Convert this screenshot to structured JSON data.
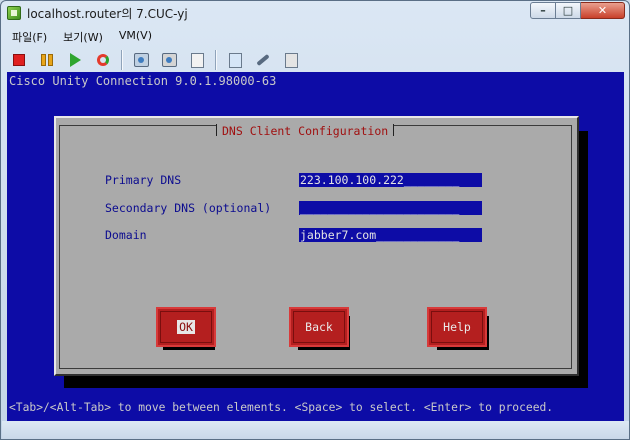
{
  "window": {
    "title": "localhost.router의 7.CUC-yj",
    "minimize_glyph": "–",
    "maximize_glyph": "□",
    "close_glyph": "✕"
  },
  "menu": {
    "items": [
      "파일(F)",
      "보기(W)",
      "VM(V)"
    ]
  },
  "toolbar": {
    "icons": [
      "power-off-icon",
      "suspend-icon",
      "power-on-icon",
      "reset-icon",
      "snapshot-icon",
      "revert-snapshot-icon",
      "snapshot-manager-icon",
      "console-view-icon",
      "vm-settings-icon",
      "tools-icon"
    ]
  },
  "console": {
    "header": "Cisco Unity Connection 9.0.1.98000-63",
    "footer": "<Tab>/<Alt-Tab> to move between elements. <Space> to select. <Enter> to proceed.",
    "colors": {
      "screen": "#0d0ca6",
      "dialog": "#aaaaaa",
      "button": "#b41f1f",
      "title": "#a01010"
    }
  },
  "dialog": {
    "title": "DNS Client Configuration",
    "fields": [
      {
        "label": "Primary DNS",
        "value": "223.100.100.222________"
      },
      {
        "label": "Secondary DNS (optional)",
        "value": "_______________________"
      },
      {
        "label": "Domain",
        "value": "jabber7.com____________"
      }
    ],
    "buttons": [
      {
        "label": "OK",
        "focused": true
      },
      {
        "label": "Back",
        "focused": false
      },
      {
        "label": "Help",
        "focused": false
      }
    ]
  }
}
